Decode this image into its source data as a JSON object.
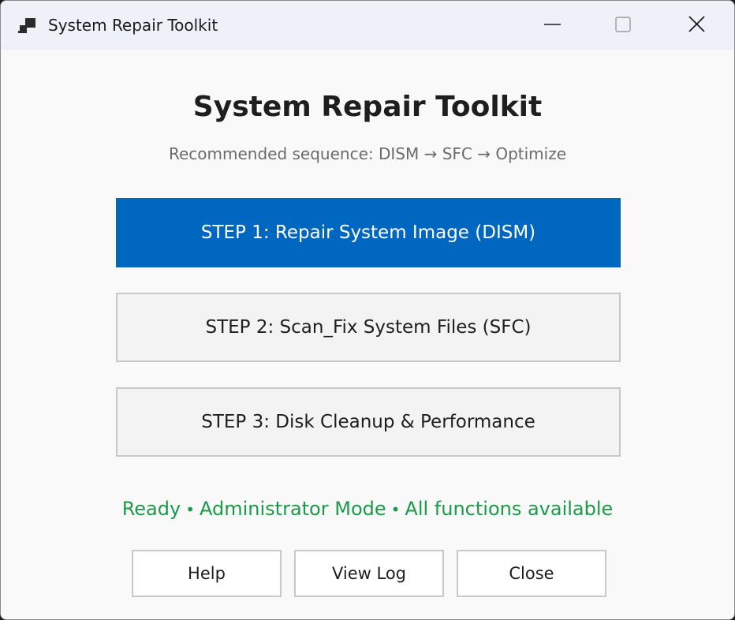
{
  "window": {
    "title": "System Repair Toolkit",
    "controls": {
      "minimize": "minimize-icon",
      "maximize": "maximize-icon",
      "close": "close-icon"
    }
  },
  "main": {
    "heading": "System Repair Toolkit",
    "subheading": "Recommended sequence: DISM → SFC → Optimize",
    "steps": [
      {
        "label": "STEP 1: Repair System Image (DISM)",
        "style": "primary"
      },
      {
        "label": "STEP 2: Scan_Fix System Files (SFC)",
        "style": "secondary"
      },
      {
        "label": "STEP 3: Disk Cleanup & Performance",
        "style": "secondary"
      }
    ],
    "status": {
      "parts": [
        "Ready",
        "Administrator Mode",
        "All functions available"
      ],
      "separator": "•"
    }
  },
  "footer": {
    "help_label": "Help",
    "view_log_label": "View Log",
    "close_label": "Close"
  },
  "colors": {
    "accent": "#0067c0",
    "status_green": "#1b9a4a",
    "titlebar_bg": "#eef2f8",
    "window_bg": "#f9f9f9"
  }
}
